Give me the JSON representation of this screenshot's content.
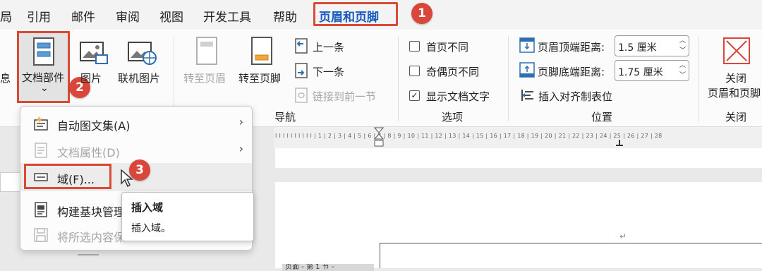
{
  "tabs": [
    {
      "label": "局"
    },
    {
      "label": "引用"
    },
    {
      "label": "邮件"
    },
    {
      "label": "审阅"
    },
    {
      "label": "视图"
    },
    {
      "label": "开发工具"
    },
    {
      "label": "帮助"
    },
    {
      "label": "页眉和页脚"
    }
  ],
  "badges": [
    "1",
    "2",
    "3"
  ],
  "insert_group": {
    "info_partial": "息",
    "doc_parts": "文档部件",
    "doc_parts_arrow": "⌄",
    "picture": "图片",
    "online_picture": "联机图片"
  },
  "nav_group": {
    "goto_header": "转至页眉",
    "goto_footer": "转至页脚",
    "prev": "上一条",
    "next": "下一条",
    "link_prev": "链接到前一节",
    "name": "导航"
  },
  "options_group": {
    "first_page": "首页不同",
    "odd_even": "奇偶页不同",
    "show_doc_text": "显示文档文字",
    "name": "选项"
  },
  "position_group": {
    "header_top_label": "页眉顶端距离:",
    "header_top_value": "1.5 厘米",
    "footer_bottom_label": "页脚底端距离:",
    "footer_bottom_value": "1.75 厘米",
    "insert_align_tab": "插入对齐制表位",
    "name": "位置"
  },
  "close_group": {
    "close_line1": "关闭",
    "close_line2": "页眉和页脚",
    "name": "关闭"
  },
  "ruler": {
    "ticks": "I I I I I I I I I I | 1 | 2 | 3 | 4 | 5 | 6 | 7 | 8 | 9 | 10 | 11 | 12 | 13 | 14 | 15 | 16 | 17 | 18 | 19 | 20 | 21 | 22 | 23 | 24 | 25 | 26 | 27 | 28"
  },
  "menu": {
    "autotext": "自动图文集(A)",
    "doc_property": "文档属性(D)",
    "field": "域(F)...",
    "building_blocks": "构建基块管理",
    "save_selection": "将所选内容保"
  },
  "tooltip": {
    "title": "插入域",
    "desc": "插入域。"
  },
  "document": {
    "paragraph_mark": "↵",
    "footer_tag": "页面 - 第 1 节 -"
  },
  "colors": {
    "accent": "#185abd",
    "highlight": "#d94a35"
  }
}
